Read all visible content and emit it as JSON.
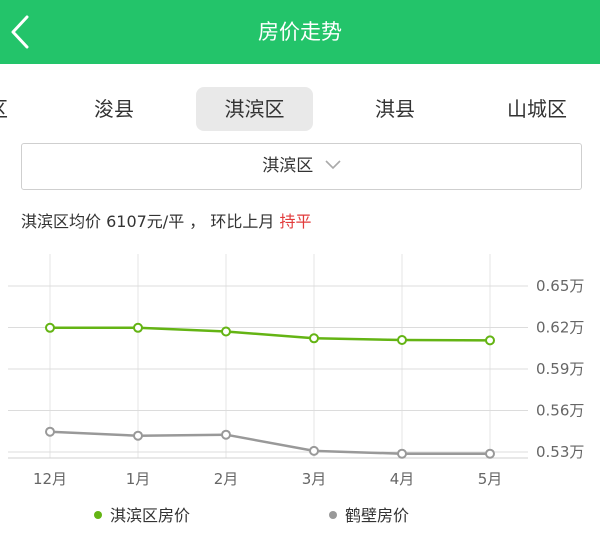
{
  "header": {
    "title": "房价走势",
    "back_icon": "chevron-left-icon"
  },
  "tabs": [
    {
      "label": "区",
      "active": false
    },
    {
      "label": "浚县",
      "active": false
    },
    {
      "label": "淇滨区",
      "active": true
    },
    {
      "label": "淇县",
      "active": false
    },
    {
      "label": "山城区",
      "active": false
    }
  ],
  "district_select": {
    "value": "淇滨区",
    "icon": "chevron-down-icon"
  },
  "summary": {
    "text": "淇滨区均价 6107元/平 ， 环比上月 ",
    "trend": "持平",
    "trend_color": "#e23b3b"
  },
  "colors": {
    "brand": "#23c46a",
    "series1": "#64b414",
    "series2": "#999999"
  },
  "chart_data": {
    "type": "line",
    "categories": [
      "12月",
      "1月",
      "2月",
      "3月",
      "4月",
      "5月"
    ],
    "y_unit": "万",
    "y_ticks": [
      "0.65万",
      "0.62万",
      "0.59万",
      "0.56万",
      "0.53万"
    ],
    "ylim": [
      0.53,
      0.65
    ],
    "grid": true,
    "legend_position": "bottom",
    "series": [
      {
        "name": "淇滨区房价",
        "color": "#64b414",
        "values": [
          0.6198,
          0.6198,
          0.6171,
          0.6122,
          0.611,
          0.6107
        ]
      },
      {
        "name": "鹤壁房价",
        "color": "#999999",
        "values": [
          0.5447,
          0.5418,
          0.5425,
          0.5308,
          0.5288,
          0.5288
        ]
      }
    ]
  }
}
